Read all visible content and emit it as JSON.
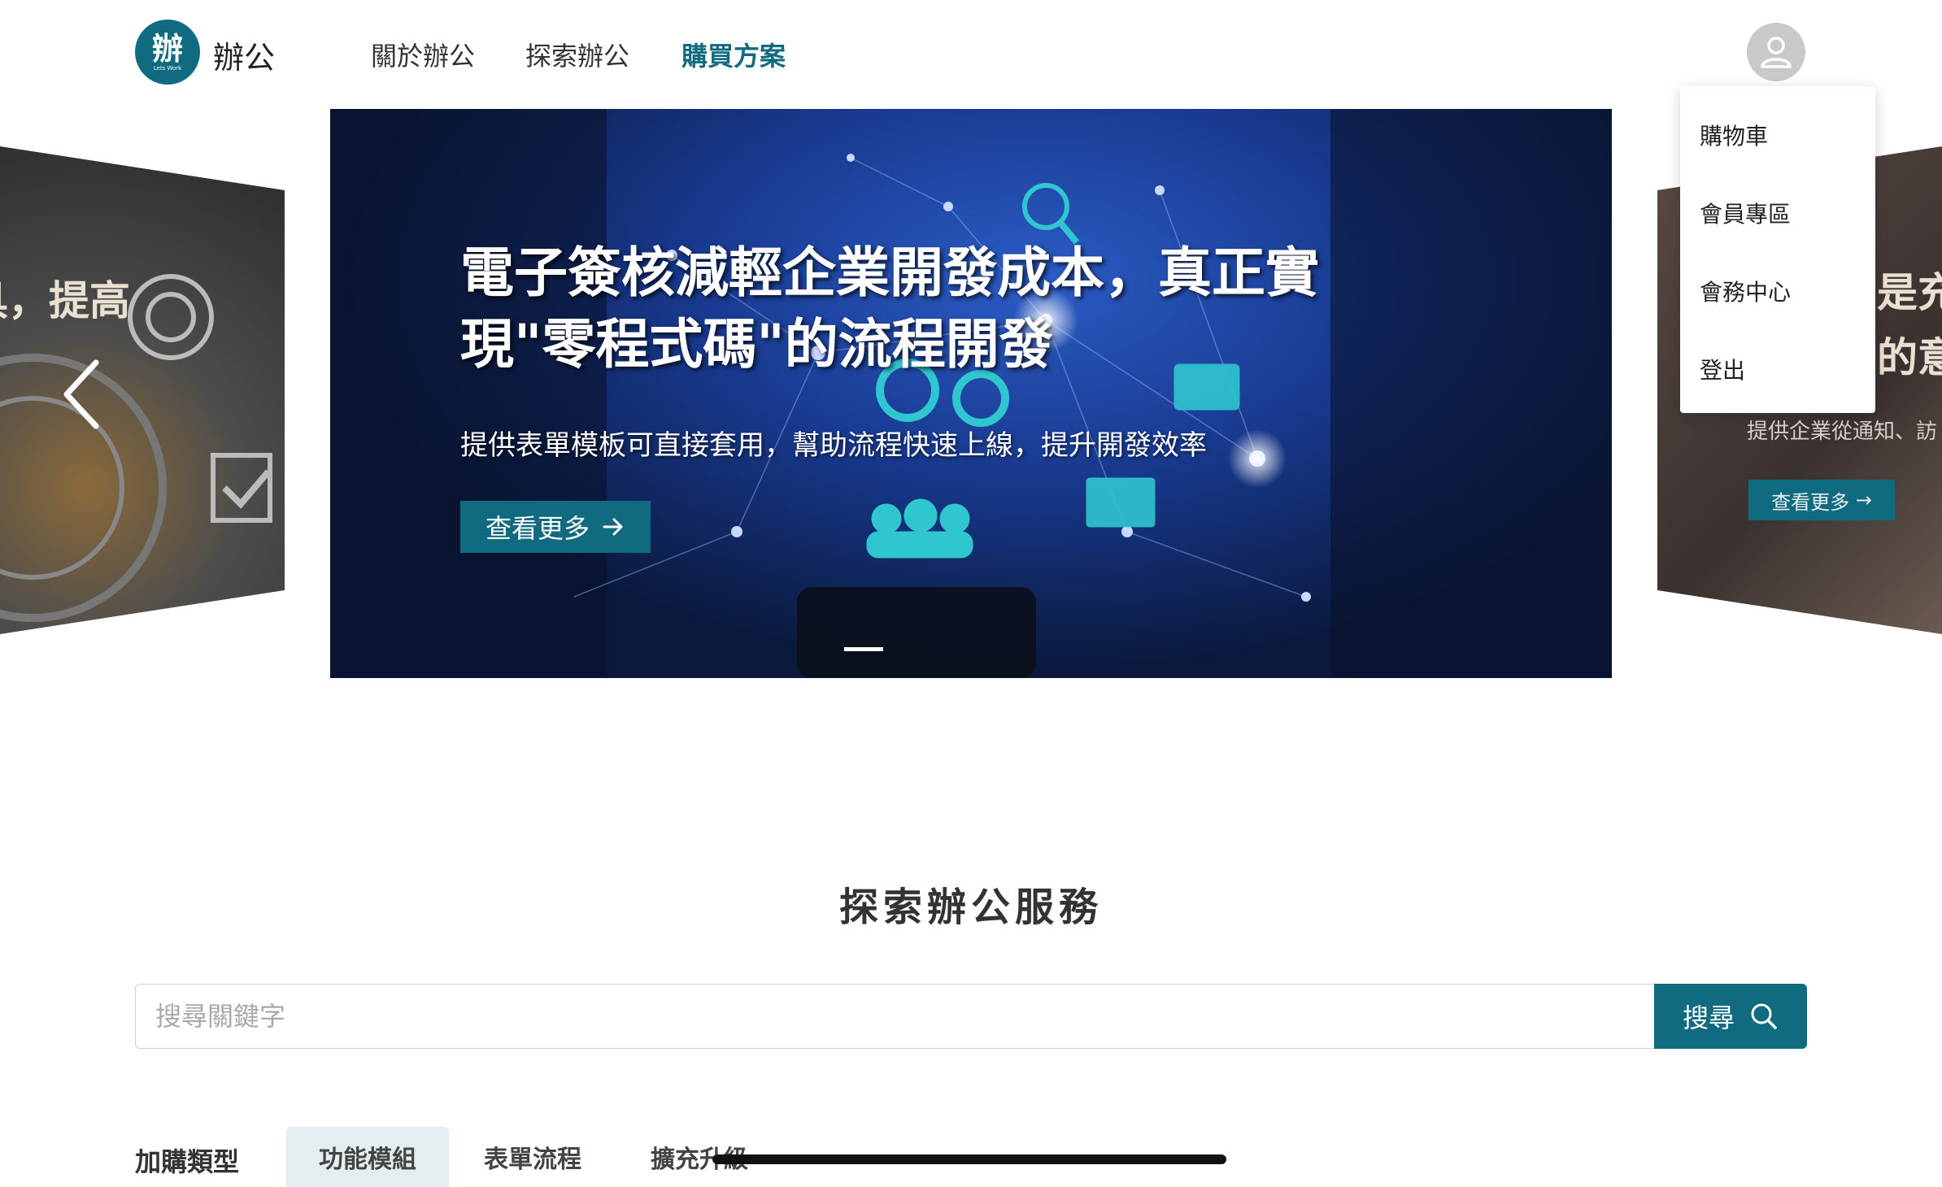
{
  "header": {
    "logo_glyph": "辦",
    "logo_sub": "Lets Work",
    "brand": "辦公",
    "nav": [
      "關於辦公",
      "探索辦公",
      "購買方案"
    ],
    "active_nav": "購買方案"
  },
  "carousel": {
    "left_peek_text": "具，提高",
    "right_peek_title": "是充\n的意",
    "right_peek_desc": "提供企業從通知、訪",
    "right_peek_button": "查看更多",
    "hero_title": "電子簽核減輕企業開發成本，真正實現\"零程式碼\"的流程開發",
    "hero_desc": "提供表單模板可直接套用，幫助流程快速上線，提升開發效率",
    "hero_button": "查看更多"
  },
  "user_menu": {
    "items": [
      "購物車",
      "會員專區",
      "會務中心",
      "登出"
    ]
  },
  "explore": {
    "title": "探索辦公服務",
    "search_placeholder": "搜尋關鍵字",
    "search_button": "搜尋"
  },
  "categories": {
    "label": "加購類型",
    "tabs": [
      "功能模組",
      "表單流程",
      "擴充升級"
    ],
    "active_tab": "功能模組"
  },
  "colors": {
    "brand": "#116b80",
    "tab_active_bg": "#e3eef1"
  }
}
